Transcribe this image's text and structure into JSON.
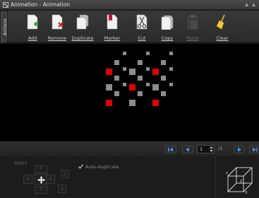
{
  "window": {
    "title": "Animation - Animation"
  },
  "sidebar": {
    "tab_label": "Actions"
  },
  "toolbar": {
    "buttons": [
      {
        "label": "Add",
        "enabled": true
      },
      {
        "label": "Remove",
        "enabled": true
      },
      {
        "label": "Duplicate",
        "enabled": true
      },
      {
        "label": "Marker",
        "enabled": true
      },
      {
        "label": "Cut",
        "enabled": true
      },
      {
        "label": "Copy",
        "enabled": true
      },
      {
        "label": "Paste",
        "enabled": false
      },
      {
        "label": "Clear",
        "enabled": true
      }
    ]
  },
  "canvas": {
    "colors": {
      "background": "#000000",
      "active": "#e00000",
      "inactive": "#8c8c8c"
    }
  },
  "navigation": {
    "current_frame": "1",
    "total": "/1"
  },
  "controls": {
    "shift_label": "SHIFT",
    "auto_duplicate_label": "Auto-duplicate",
    "auto_duplicate_checked": true,
    "pad": {
      "up": "Y",
      "down": "Y",
      "left": "X",
      "right": "X",
      "z_up": "Z",
      "z_down": "Z"
    }
  },
  "cube": {
    "axes": [
      "Y",
      "Z",
      "X"
    ]
  }
}
